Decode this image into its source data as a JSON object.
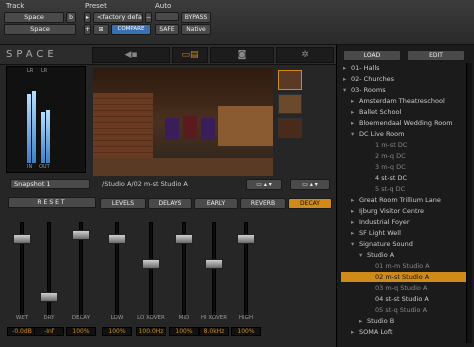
{
  "header": {
    "track_label": "Track",
    "preset_label": "Preset",
    "auto_label": "Auto",
    "track_name": "Space",
    "track_insert": "b",
    "track_name2": "Space",
    "preset_value": "<factory default>",
    "compare": "COMPARE",
    "bypass": "BYPASS",
    "safe": "SAFE",
    "native": "Native",
    "plus": "+",
    "minus": "−",
    "copy": "⊞"
  },
  "plugin": {
    "name": "SPACE"
  },
  "meters": {
    "labels": [
      "LR",
      "LR",
      "IN",
      "OUT"
    ],
    "levels": [
      0.78,
      0.82,
      0.58,
      0.6
    ]
  },
  "snapshot": {
    "name": "Snapshot 1",
    "path": "/Studio A/02 m-st Studio A"
  },
  "tabs": [
    "LEVELS",
    "DELAYS",
    "EARLY",
    "REVERB",
    "DECAY"
  ],
  "reset": "RESET",
  "faders": [
    {
      "label": "WET",
      "value": "-0.0dB",
      "pos": 0.15
    },
    {
      "label": "DRY",
      "value": "-Inf",
      "pos": 0.85
    },
    {
      "label": "DECAY",
      "value": "100%",
      "pos": 0.1
    },
    {
      "label": "LOW",
      "value": "100%",
      "pos": 0.15
    },
    {
      "label": "LO XOVER",
      "value": "100.0Hz",
      "pos": 0.45
    },
    {
      "label": "MID",
      "value": "100%",
      "pos": 0.15
    },
    {
      "label": "HI XOVER",
      "value": "8.0kHz",
      "pos": 0.45
    },
    {
      "label": "HIGH",
      "value": "100%",
      "pos": 0.15
    }
  ],
  "browser": {
    "load": "LOAD",
    "edit": "EDIT",
    "items": [
      {
        "t": "01- Halls",
        "i": 0,
        "a": "▸",
        "d": false
      },
      {
        "t": "02- Churches",
        "i": 0,
        "a": "▸",
        "d": false
      },
      {
        "t": "03- Rooms",
        "i": 0,
        "a": "▾",
        "d": false
      },
      {
        "t": "Amsterdam Theatreschool",
        "i": 1,
        "a": "▸",
        "d": false
      },
      {
        "t": "Ballet School",
        "i": 1,
        "a": "▸",
        "d": false
      },
      {
        "t": "Bloemendaal Wedding Room",
        "i": 1,
        "a": "▸",
        "d": false
      },
      {
        "t": "DC Live Room",
        "i": 1,
        "a": "▾",
        "d": false
      },
      {
        "t": "1 m-st DC",
        "i": 3,
        "a": "",
        "d": true
      },
      {
        "t": "2 m-q DC",
        "i": 3,
        "a": "",
        "d": true
      },
      {
        "t": "3 m-q DC",
        "i": 3,
        "a": "",
        "d": true
      },
      {
        "t": "4 st-st DC",
        "i": 3,
        "a": "",
        "d": false
      },
      {
        "t": "5 st-q DC",
        "i": 3,
        "a": "",
        "d": true
      },
      {
        "t": "Great Room Trillium Lane",
        "i": 1,
        "a": "▸",
        "d": false
      },
      {
        "t": "Ijburg Visitor Centre",
        "i": 1,
        "a": "▸",
        "d": false
      },
      {
        "t": "Industrial Foyer",
        "i": 1,
        "a": "▸",
        "d": false
      },
      {
        "t": "SF Light Well",
        "i": 1,
        "a": "▸",
        "d": false
      },
      {
        "t": "Signature Sound",
        "i": 1,
        "a": "▾",
        "d": false
      },
      {
        "t": "Studio A",
        "i": 2,
        "a": "▾",
        "d": false
      },
      {
        "t": "01 m-m Studio A",
        "i": 3,
        "a": "",
        "d": true
      },
      {
        "t": "02 m-st Studio A",
        "i": 3,
        "a": "",
        "d": false,
        "s": true
      },
      {
        "t": "03 m-q Studio A",
        "i": 3,
        "a": "",
        "d": true
      },
      {
        "t": "04 st-st Studio A",
        "i": 3,
        "a": "",
        "d": false
      },
      {
        "t": "05 st-q Studio A",
        "i": 3,
        "a": "",
        "d": true
      },
      {
        "t": "Studio B",
        "i": 2,
        "a": "▸",
        "d": false
      },
      {
        "t": "SOMA Loft",
        "i": 1,
        "a": "▸",
        "d": false
      }
    ]
  }
}
